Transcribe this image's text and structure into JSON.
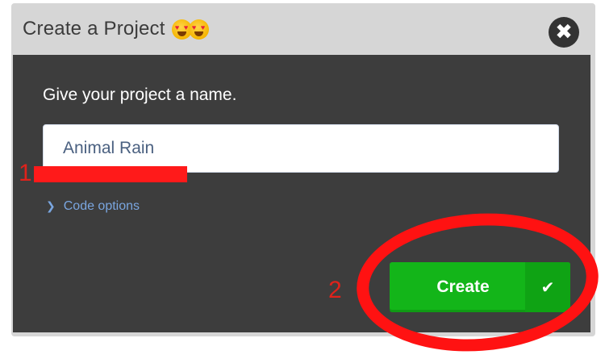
{
  "dialog": {
    "title": "Create a Project",
    "title_emoji": "heart-eyes-emoji",
    "close_icon": "close-icon"
  },
  "form": {
    "prompt": "Give your project a name.",
    "project_name_value": "Animal Rain",
    "code_options_label": "Code options",
    "code_options_icon": "chevron-right-icon"
  },
  "actions": {
    "create_label": "Create",
    "create_icon": "check-icon"
  },
  "annotations": {
    "step1": "1",
    "step2": "2",
    "color": "#ff1a1a"
  },
  "colors": {
    "title_bar": "#d6d6d6",
    "panel": "#3d3d3d",
    "create_button": "#13b519",
    "link": "#7aa6e0"
  }
}
